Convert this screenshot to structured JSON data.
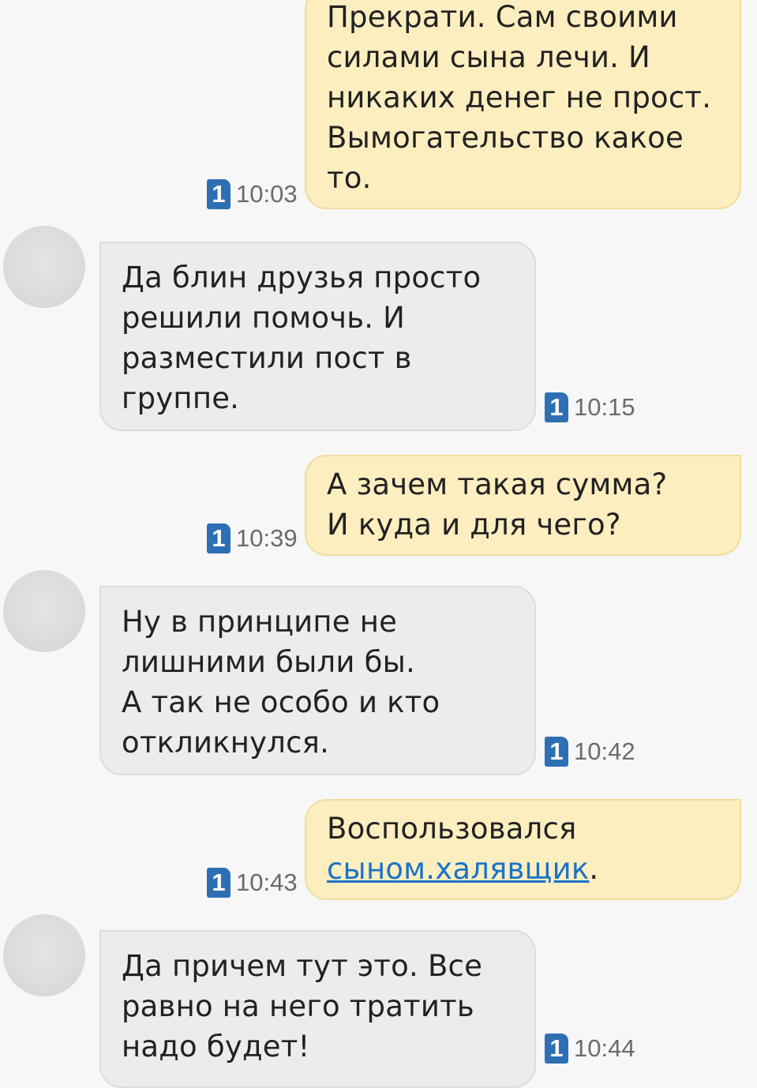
{
  "messages": [
    {
      "direction": "out",
      "lines": [
        "Прекрати. Сам своими",
        "силами сына лечи. И",
        "никаких денег не прост.",
        "Вымогательство какое",
        "то."
      ],
      "sim": "1",
      "time": "10:03"
    },
    {
      "direction": "in",
      "lines": [
        "Да блин друзья просто",
        "решили помочь. И",
        "разместили пост в",
        "группе."
      ],
      "sim": "1",
      "time": "10:15"
    },
    {
      "direction": "out",
      "lines": [
        "А зачем такая  сумма?",
        "И куда и для чего?"
      ],
      "sim": "1",
      "time": "10:39"
    },
    {
      "direction": "in",
      "lines": [
        "Ну в принципе не",
        "лишними были бы.",
        "А так не особо и кто",
        "откликнулся."
      ],
      "sim": "1",
      "time": "10:42"
    },
    {
      "direction": "out",
      "lines": [
        "Воспользовался"
      ],
      "link_text": "сыном.халявщик",
      "after_link": ".",
      "sim": "1",
      "time": "10:43"
    },
    {
      "direction": "in",
      "lines": [
        "Да причем тут это. Все",
        "равно на него тратить",
        "надо будет!"
      ],
      "sim": "1",
      "time": "10:44"
    }
  ],
  "colors": {
    "background": "#f7f7f7",
    "outgoing_bubble": "#fdeec0",
    "incoming_bubble": "#ececec",
    "sim_badge": "#2e6fb4",
    "link": "#1a73c9",
    "timestamp": "#6b6b6b"
  }
}
